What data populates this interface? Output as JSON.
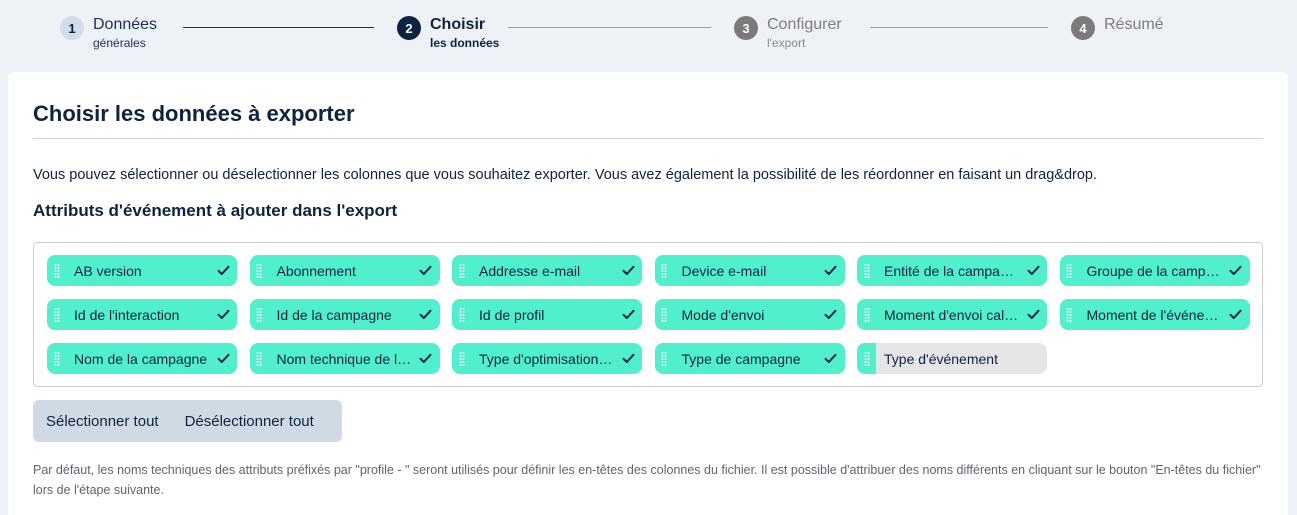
{
  "stepper": {
    "steps": [
      {
        "num": "1",
        "title": "Données",
        "sub": "générales",
        "state": "done"
      },
      {
        "num": "2",
        "title": "Choisir",
        "sub": "les données",
        "state": "active"
      },
      {
        "num": "3",
        "title": "Configurer",
        "sub": "l'export",
        "state": "todo"
      },
      {
        "num": "4",
        "title": "Résumé",
        "sub": "",
        "state": "todo"
      }
    ]
  },
  "main": {
    "title": "Choisir les données à exporter",
    "intro": "Vous pouvez sélectionner ou déselectionner les colonnes que vous souhaitez exporter. Vous avez également la possibilité de les réordonner en faisant un drag&drop.",
    "section_title": "Attributs d'événement à ajouter dans l'export",
    "chips": [
      {
        "label": "AB version",
        "selected": true
      },
      {
        "label": "Abonnement",
        "selected": true
      },
      {
        "label": "Addresse e-mail",
        "selected": true
      },
      {
        "label": "Device e-mail",
        "selected": true
      },
      {
        "label": "Entité de la campag…",
        "selected": true
      },
      {
        "label": "Groupe de la campa…",
        "selected": true
      },
      {
        "label": "Id de l'interaction",
        "selected": true
      },
      {
        "label": "Id de la campagne",
        "selected": true
      },
      {
        "label": "Id de profil",
        "selected": true
      },
      {
        "label": "Mode d'envoi",
        "selected": true
      },
      {
        "label": "Moment d'envoi cal…",
        "selected": true
      },
      {
        "label": "Moment de l'événe…",
        "selected": true
      },
      {
        "label": "Nom de la campagne",
        "selected": true
      },
      {
        "label": "Nom technique de l…",
        "selected": true
      },
      {
        "label": "Type d'optimisation …",
        "selected": true
      },
      {
        "label": "Type de campagne",
        "selected": true
      },
      {
        "label": "Type d'événement",
        "selected": false
      }
    ],
    "buttons": {
      "select_all": "Sélectionner tout",
      "deselect_all": "Désélectionner tout"
    },
    "footnote": "Par défaut, les noms techniques des attributs préfixés par \"profile - \" seront utilisés pour définir les en-têtes des colonnes du fichier. Il est possible d'attribuer des noms différents en cliquant sur le bouton \"En-têtes du fichier\" lors de l'étape suivante."
  },
  "colors": {
    "chip_selected": "#4ff0cb",
    "chip_unselected": "#e5e5e5",
    "primary_dark": "#0d2340",
    "button_group_bg": "#cfdae5"
  }
}
